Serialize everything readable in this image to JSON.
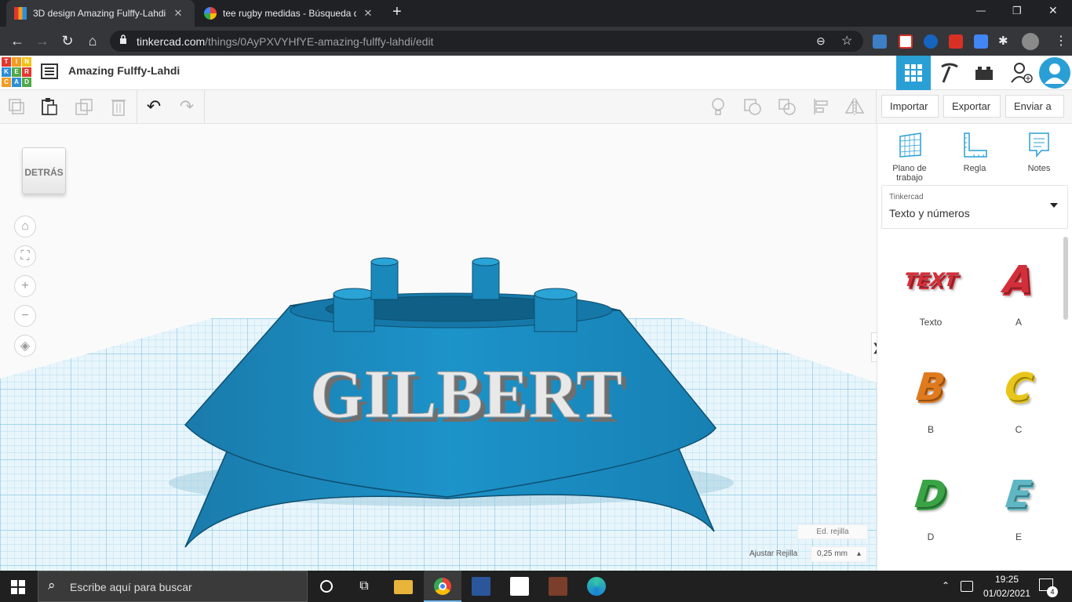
{
  "browser": {
    "tabs": [
      {
        "title": "3D design Amazing Fulffy-Lahdi |",
        "close": "✕"
      },
      {
        "title": "tee rugby medidas - Búsqueda d",
        "close": "✕"
      }
    ],
    "new_tab": "+",
    "url_host": "tinkercad.com",
    "url_path": "/things/0AyPXVYHfYE-amazing-fulffy-lahdi/edit",
    "window_controls": {
      "minimize": "—",
      "restore": "❐",
      "close": "✕"
    }
  },
  "app": {
    "logo_letters": [
      "T",
      "I",
      "N",
      "K",
      "E",
      "R",
      "C",
      "A",
      "D"
    ],
    "logo_colors": [
      "#e2362f",
      "#f39c20",
      "#f0c419",
      "#2c8fd6",
      "#50a848",
      "#e2362f",
      "#f39c20",
      "#2c8fd6",
      "#50a848"
    ],
    "design_title": "Amazing Fulffy-Lahdi",
    "accent": "#2a9fd6"
  },
  "actions": {
    "import": "Importar",
    "export": "Exportar",
    "send_to": "Enviar a"
  },
  "view": {
    "viewcube_label": "DETRÁS",
    "model_text": "GILBERT",
    "edit_grid": "Ed. rejilla",
    "snap_grid_label": "Ajustar Rejilla",
    "snap_grid_value": "0,25 mm",
    "snap_arrow": "▴"
  },
  "panel": {
    "nav": [
      {
        "label_line1": "Plano de",
        "label_line2": "trabajo"
      },
      {
        "label_line1": "Regla",
        "label_line2": ""
      },
      {
        "label_line1": "Notes",
        "label_line2": ""
      }
    ],
    "library_source": "Tinkercad",
    "library_name": "Texto y números",
    "collapse_arrow": "❯",
    "shapes": [
      {
        "label": "Texto",
        "color": "#d32f3a"
      },
      {
        "label": "A",
        "color": "#d32f3a"
      },
      {
        "label": "B",
        "color": "#e07a1f"
      },
      {
        "label": "C",
        "color": "#e8c619"
      },
      {
        "label": "D",
        "color": "#3aa346"
      },
      {
        "label": "E",
        "color": "#5fb7c4"
      }
    ],
    "shape_glyphs": {
      "Texto": "TEXT",
      "A": "A",
      "B": "B",
      "C": "C",
      "D": "D",
      "E": "E"
    }
  },
  "taskbar": {
    "search_placeholder": "Escribe aquí para buscar",
    "time": "19:25",
    "date": "01/02/2021",
    "notifications": "4"
  }
}
